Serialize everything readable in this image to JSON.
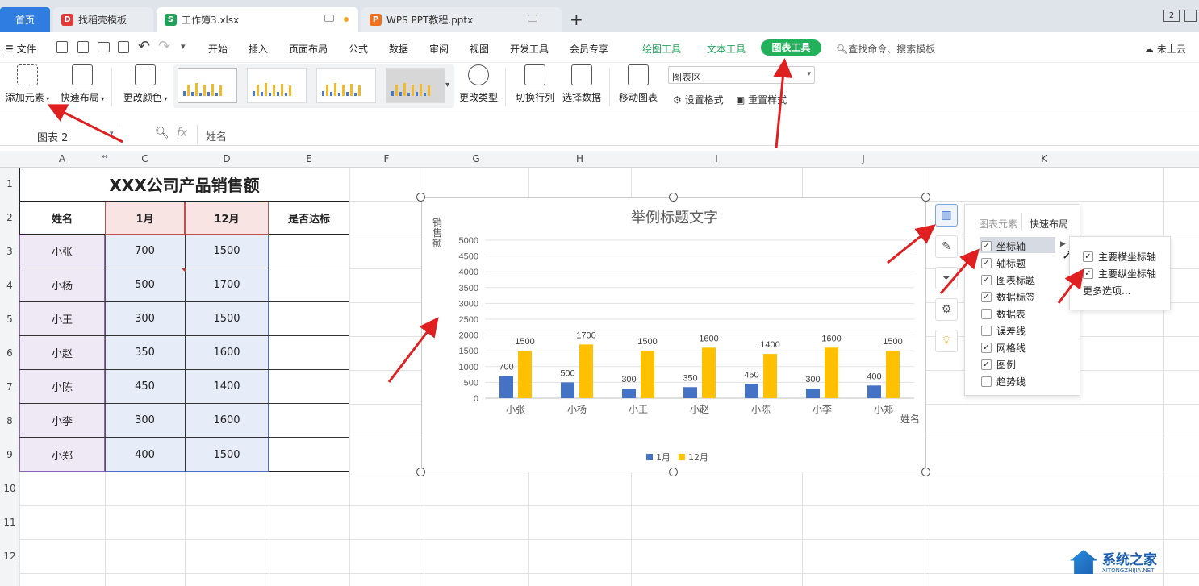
{
  "tabs": {
    "home": "首页",
    "tab1": "找稻壳模板",
    "tab2": "工作簿3.xlsx",
    "tab3": "WPS PPT教程.pptx",
    "add": "+",
    "page_indicator": "2"
  },
  "menu": {
    "file": "文件",
    "items": [
      "开始",
      "插入",
      "页面布局",
      "公式",
      "数据",
      "审阅",
      "视图",
      "开发工具",
      "会员专享"
    ],
    "drawing_tools": "绘图工具",
    "text_tools": "文本工具",
    "chart_tools": "图表工具",
    "search": "查找命令、搜索模板",
    "cloud": "未上云"
  },
  "ribbon": {
    "add_element": "添加元素",
    "quick_layout": "快速布局",
    "change_color": "更改颜色",
    "change_type": "更改类型",
    "switch_row_col": "切换行列",
    "select_data": "选择数据",
    "move_chart": "移动图表",
    "area_select": "图表区",
    "set_format": "设置格式",
    "reset_style": "重置样式"
  },
  "formula": {
    "name_box": "图表 2",
    "fx": "fx",
    "value": "姓名"
  },
  "columns": [
    "A",
    "C",
    "D",
    "E",
    "F",
    "G",
    "H",
    "I",
    "J",
    "K"
  ],
  "rows": [
    "1",
    "2",
    "3",
    "4",
    "5",
    "6",
    "7",
    "8",
    "9",
    "10",
    "11",
    "12"
  ],
  "sheet": {
    "title": "XXX公司产品销售额",
    "headers": [
      "姓名",
      "1月",
      "12月",
      "是否达标"
    ],
    "data": [
      [
        "小张",
        "700",
        "1500",
        ""
      ],
      [
        "小杨",
        "500",
        "1700",
        ""
      ],
      [
        "小王",
        "300",
        "1500",
        ""
      ],
      [
        "小赵",
        "350",
        "1600",
        ""
      ],
      [
        "小陈",
        "450",
        "1400",
        ""
      ],
      [
        "小李",
        "300",
        "1600",
        ""
      ],
      [
        "小郑",
        "400",
        "1500",
        ""
      ]
    ]
  },
  "chart_data": {
    "type": "bar",
    "title": "举例标题文字",
    "ylabel": "销售额",
    "xlabel": "姓名",
    "categories": [
      "小张",
      "小杨",
      "小王",
      "小赵",
      "小陈",
      "小李",
      "小郑"
    ],
    "series": [
      {
        "name": "1月",
        "values": [
          700,
          500,
          300,
          350,
          450,
          300,
          400
        ],
        "color": "#4472c4"
      },
      {
        "name": "12月",
        "values": [
          1500,
          1700,
          1500,
          1600,
          1400,
          1600,
          1500
        ],
        "color": "#ffc000"
      }
    ],
    "ylim": [
      0,
      5000
    ],
    "yticks": [
      "0",
      "500",
      "1000",
      "1500",
      "2000",
      "2500",
      "3000",
      "3500",
      "4000",
      "4500",
      "5000"
    ],
    "grid": true,
    "legend": "bottom"
  },
  "panel": {
    "tab_elements": "图表元素",
    "tab_layout": "快速布局",
    "items": [
      {
        "label": "坐标轴",
        "checked": true
      },
      {
        "label": "轴标题",
        "checked": true
      },
      {
        "label": "图表标题",
        "checked": true
      },
      {
        "label": "数据标签",
        "checked": true
      },
      {
        "label": "数据表",
        "checked": false
      },
      {
        "label": "误差线",
        "checked": false
      },
      {
        "label": "网格线",
        "checked": true
      },
      {
        "label": "图例",
        "checked": true
      },
      {
        "label": "趋势线",
        "checked": false
      }
    ],
    "sub": {
      "primary_h": "主要横坐标轴",
      "primary_v": "主要纵坐标轴",
      "more": "更多选项..."
    }
  },
  "watermark": {
    "name": "系统之家",
    "url": "XITONGZHIJIA.NET"
  }
}
